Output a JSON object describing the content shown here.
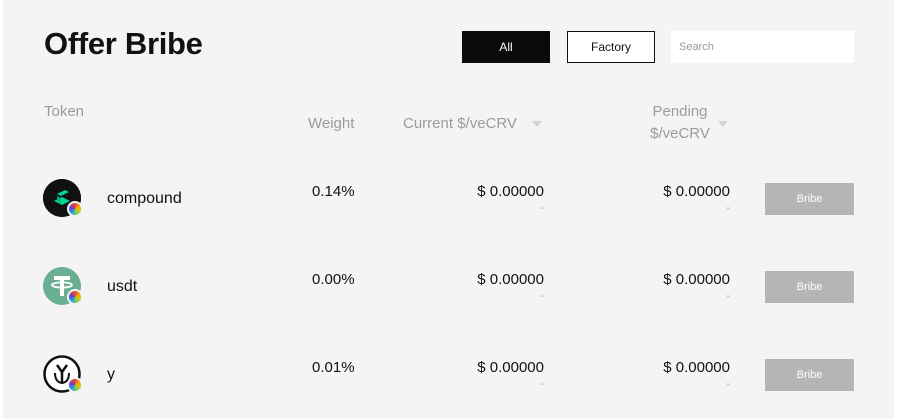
{
  "page": {
    "title": "Offer Bribe"
  },
  "filters": {
    "all_label": "All",
    "factory_label": "Factory",
    "active": "All"
  },
  "search": {
    "placeholder": "Search",
    "value": ""
  },
  "columns": {
    "token": "Token",
    "weight": "Weight",
    "current": "Current $/veCRV",
    "pending_line1": "Pending",
    "pending_line2": "$/veCRV"
  },
  "rows": [
    {
      "name": "compound",
      "icon": "compound-token-icon",
      "weight": "0.14%",
      "current": "$ 0.00000",
      "current_sub": "-",
      "pending": "$ 0.00000",
      "pending_sub": "-",
      "action": "Bribe"
    },
    {
      "name": "usdt",
      "icon": "usdt-token-icon",
      "weight": "0.00%",
      "current": "$ 0.00000",
      "current_sub": "-",
      "pending": "$ 0.00000",
      "pending_sub": "-",
      "action": "Bribe"
    },
    {
      "name": "y",
      "icon": "yearn-token-icon",
      "weight": "0.01%",
      "current": "$ 0.00000",
      "current_sub": "-",
      "pending": "$ 0.00000",
      "pending_sub": "-",
      "action": "Bribe"
    }
  ],
  "colors": {
    "background": "#f4f4f4",
    "button_dark": "#0b0b0b",
    "bribe_button": "#b5b5b5",
    "muted_text": "#9b9b9b",
    "usdt_green": "#6aae94"
  }
}
